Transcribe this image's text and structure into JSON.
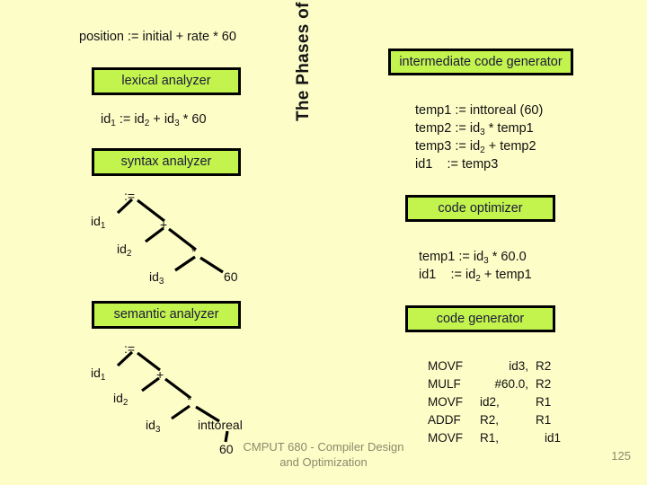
{
  "slide": {
    "background_color": "#fdfdc8",
    "box_fill_color": "#c3f34d",
    "box_border_color": "#000000",
    "vertical_title": "The Phases of a Compiler"
  },
  "source": {
    "expression": "position := initial + rate * 60"
  },
  "phases": {
    "lexical_analyzer": "lexical analyzer",
    "syntax_analyzer": "syntax analyzer",
    "semantic_analyzer": "semantic analyzer",
    "intermediate_code_generator": "intermediate code generator",
    "code_optimizer": "code optimizer",
    "code_generator": "code generator"
  },
  "token_stream": {
    "line": "id1 := id2 + id3 * 60",
    "parts": {
      "id1": "id",
      "sub1": "1",
      "assign": " := ",
      "id2": "id",
      "sub2": "2",
      "plus": " + ",
      "id3": "id",
      "sub3": "3",
      "times": " * ",
      "sixty": "60"
    }
  },
  "syntax_tree": {
    "nodes": [
      {
        "label": "root",
        "text": ":=",
        "sub": ""
      },
      {
        "label": "lhs",
        "text": "id",
        "sub": "1"
      },
      {
        "label": "plus",
        "text": "+",
        "sub": ""
      },
      {
        "label": "addend",
        "text": "id",
        "sub": "2"
      },
      {
        "label": "times",
        "text": "*",
        "sub": ""
      },
      {
        "label": "factor",
        "text": "id",
        "sub": "3"
      },
      {
        "label": "constant",
        "text": "60",
        "sub": ""
      }
    ]
  },
  "semantic_tree": {
    "nodes": [
      {
        "label": "root",
        "text": ":=",
        "sub": ""
      },
      {
        "label": "lhs",
        "text": "id",
        "sub": "1"
      },
      {
        "label": "plus",
        "text": "+",
        "sub": ""
      },
      {
        "label": "addend",
        "text": "id",
        "sub": "2"
      },
      {
        "label": "times",
        "text": "*",
        "sub": ""
      },
      {
        "label": "factor",
        "text": "id",
        "sub": "3"
      },
      {
        "label": "coercion",
        "text": "inttoreal",
        "sub": ""
      },
      {
        "label": "constant",
        "text": "60",
        "sub": ""
      }
    ]
  },
  "intermediate_code": {
    "lines": [
      {
        "target": "temp1",
        "op": " := ",
        "expr_a": "inttoreal (60)",
        "expr_b": "",
        "sub_a": "",
        "sub_b": ""
      },
      {
        "target": "temp2",
        "op": " := ",
        "expr_a": "id",
        "sub_a": "3",
        "expr_b": " * temp1",
        "sub_b": ""
      },
      {
        "target": "temp3",
        "op": " := ",
        "expr_a": "id",
        "sub_a": "2",
        "expr_b": " + temp2",
        "sub_b": ""
      },
      {
        "target": "id1   ",
        "op": " := ",
        "expr_a": "temp3",
        "sub_a": "",
        "expr_b": "",
        "sub_b": ""
      }
    ]
  },
  "optimized_code": {
    "lines": [
      {
        "target": "temp1",
        "op": " := ",
        "expr_a": "id",
        "sub_a": "3",
        "expr_b": " * 60.0"
      },
      {
        "target": "id1   ",
        "op": " := ",
        "expr_a": "id",
        "sub_a": "2",
        "expr_b": " + temp1"
      }
    ]
  },
  "assembly": {
    "rows": [
      {
        "op": "MOVF",
        "arg1": "id3,",
        "arg2": "R2"
      },
      {
        "op": "MULF",
        "arg1": "#60.0,",
        "arg2": "R2"
      },
      {
        "op": "MOVF",
        "arg1": "id2,",
        "arg2": "R1"
      },
      {
        "op": "ADDF",
        "arg1": "R2,",
        "arg2": "R1"
      },
      {
        "op": "MOVF",
        "arg1": "R1,",
        "arg2": "id1"
      }
    ]
  },
  "footer": {
    "line1": "CMPUT 680 - Compiler Design",
    "line2": "and Optimization",
    "page": "125"
  }
}
